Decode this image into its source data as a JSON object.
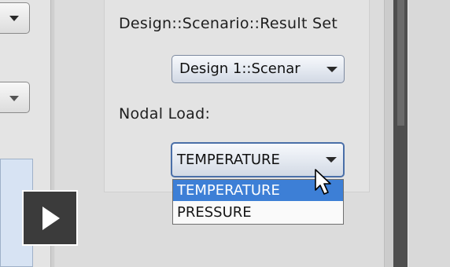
{
  "panel": {
    "result_set_label": "Design::Scenario::Result Set",
    "result_set_value": "Design 1::Scenar",
    "nodal_load_label": "Nodal Load:",
    "nodal_load_value": "TEMPERATURE"
  },
  "dropdown": {
    "options": [
      "TEMPERATURE",
      "PRESSURE"
    ],
    "highlighted": "TEMPERATURE"
  },
  "overlay": {
    "icon": "play-icon"
  },
  "colors": {
    "highlight": "#3d7fd6",
    "scrollbar": "#4e4e4e"
  }
}
